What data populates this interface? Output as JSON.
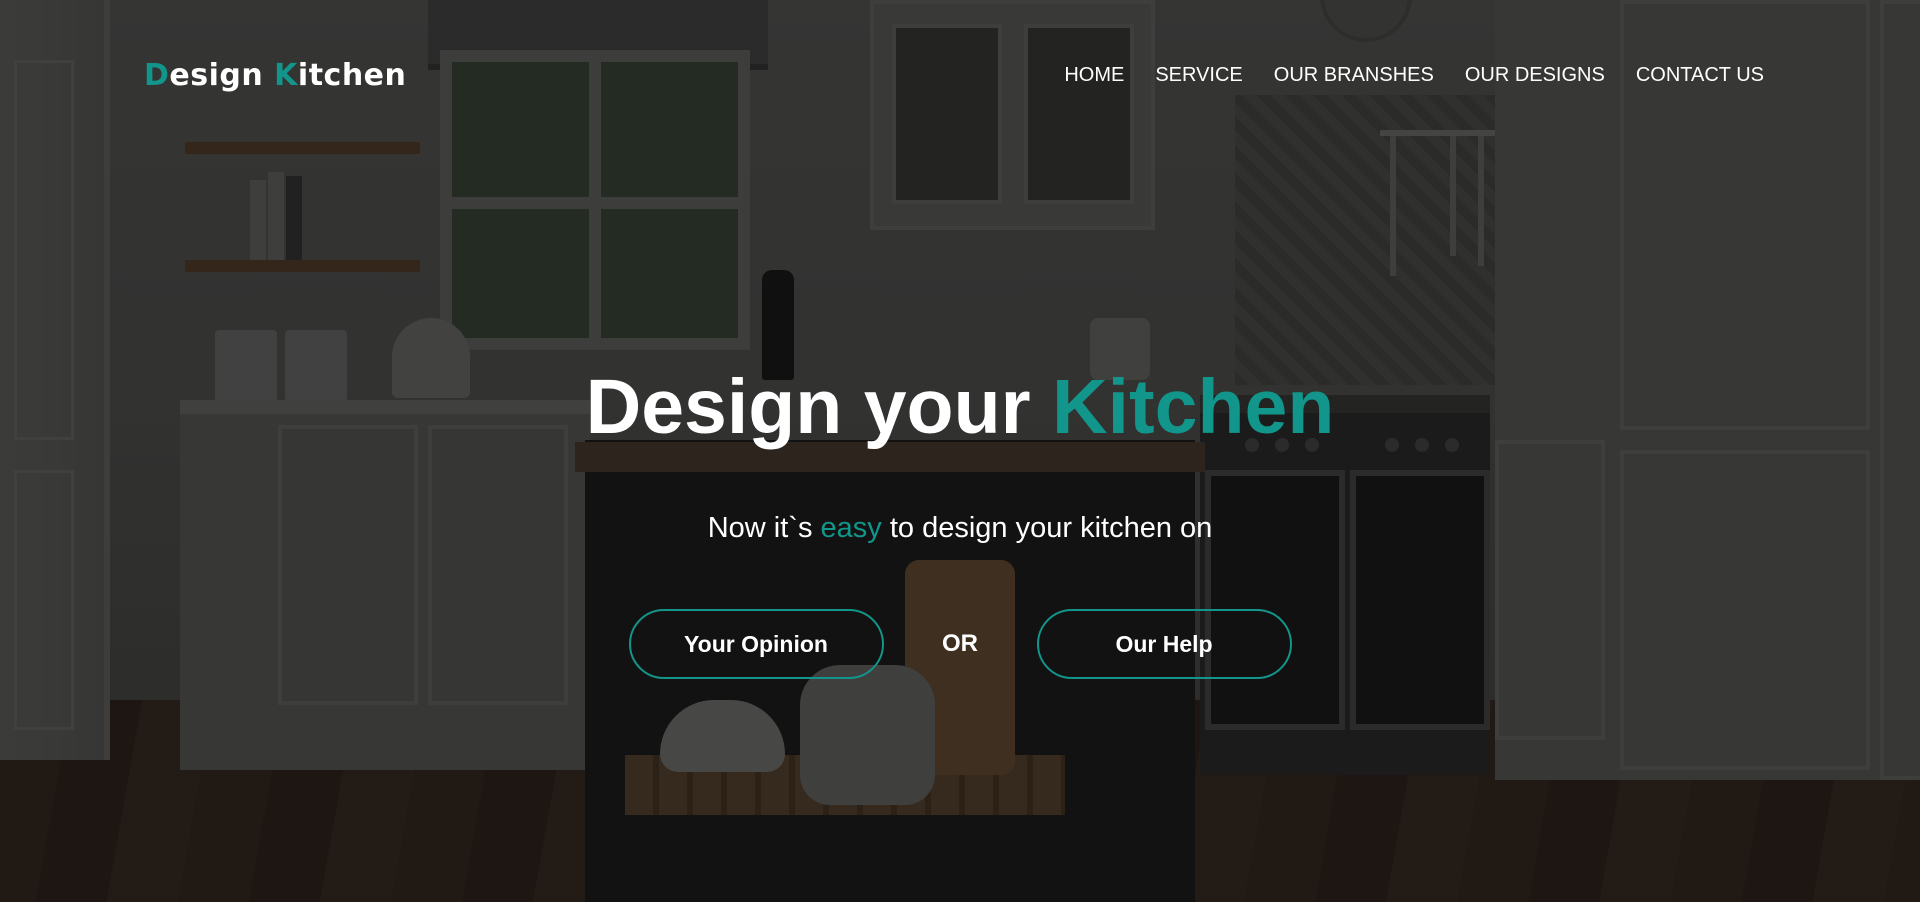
{
  "logo": {
    "first_initial": "D",
    "first_rest": "esign ",
    "second_initial": "K",
    "second_rest": "itchen"
  },
  "nav": {
    "items": [
      "HOME",
      "SERVICE",
      "OUR BRANSHES",
      "OUR DESIGNS",
      "CONTACT US"
    ]
  },
  "hero": {
    "title_plain": "Design your ",
    "title_accent": "Kitchen",
    "subtitle_before": "Now it`s ",
    "subtitle_accent": "easy",
    "subtitle_after": " to design your kitchen on",
    "primary_button": "Your Opinion",
    "separator": "OR",
    "secondary_button": "Our Help"
  },
  "colors": {
    "accent": "#12958a",
    "text": "#ffffff",
    "overlay": "rgba(0,0,0,0.42)"
  },
  "icons": {
    "background": "kitchen-photo"
  }
}
